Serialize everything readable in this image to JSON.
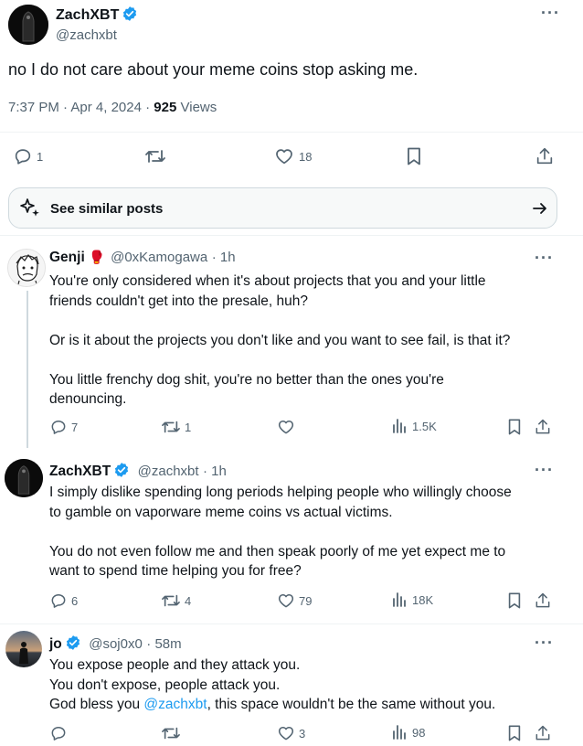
{
  "main_post": {
    "author_name": "ZachXBT",
    "handle": "@zachxbt",
    "text": "no I do not care about your meme coins stop asking me.",
    "time": "7:37 PM",
    "dot": "·",
    "date": "Apr 4, 2024",
    "views_count": "925",
    "views_label": "Views",
    "replies": "1",
    "reposts": "",
    "likes": "18"
  },
  "similar": {
    "label": "See similar posts"
  },
  "replies": [
    {
      "author_name": "Genji",
      "emoji": "🥊",
      "handle": "@0xKamogawa",
      "time": "· 1h",
      "text": "You're only considered when it's about projects that you and your little\nfriends couldn't get into the presale, huh?\n\nOr is it about the projects you don't like and you want to see fail, is that it?\n\nYou little frenchy dog shit, you're no better than the ones you're\ndenouncing.",
      "replies": "7",
      "reposts": "1",
      "likes": "",
      "views": "1.5K"
    },
    {
      "author_name": "ZachXBT",
      "handle": "@zachxbt",
      "time": "· 1h",
      "text": "I simply dislike spending long periods helping people who willingly choose\nto gamble on vaporware meme coins vs actual victims.\n\nYou do not even follow me and then speak poorly of me yet expect me to\nwant to spend time helping you for free?",
      "replies": "6",
      "reposts": "4",
      "likes": "79",
      "views": "18K"
    },
    {
      "author_name": "jo",
      "handle": "@soj0x0",
      "time": "· 58m",
      "text_line1": "You expose people and they attack you.",
      "text_line2": "You don't expose, people attack you.",
      "text_line3_pre": "God bless you ",
      "mention": "@zachxbt",
      "text_line3_post": ", this space wouldn't be the same without you.",
      "replies": "",
      "reposts": "",
      "likes": "3",
      "views": "98"
    }
  ],
  "icons": {
    "reply": "reply-icon",
    "repost": "repost-icon",
    "like": "heart-icon",
    "bookmark": "bookmark-icon",
    "share": "share-icon",
    "views": "views-icon",
    "more": "more-icon",
    "sparkle": "sparkle-icon",
    "arrow": "arrow-right-icon",
    "verified": "verified-badge-icon"
  },
  "colors": {
    "accent": "#1d9bf0",
    "muted": "#536471",
    "text": "#0f1419"
  }
}
